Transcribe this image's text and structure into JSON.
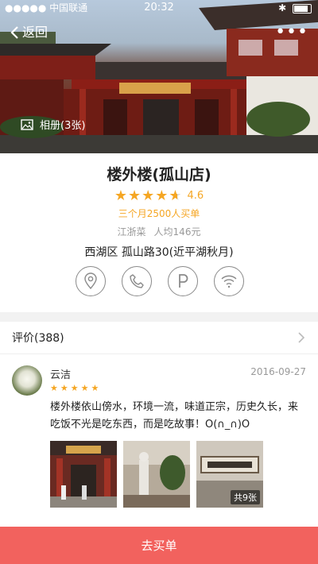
{
  "status_bar": {
    "carrier": "●●●●● 中国联通",
    "time": "20:32"
  },
  "header": {
    "back_label": "返回",
    "more_label": "•••",
    "album_label": "相册(3张)"
  },
  "shop": {
    "name": "楼外楼(孤山店)",
    "stars": "★★★★★",
    "rating": "4.6",
    "rating_fraction": 0.92,
    "sales": "三个月2500人买单",
    "cuisine": "江浙菜",
    "avg_price": "人均146元",
    "address": "西湖区 孤山路30(近平湖秋月)"
  },
  "actions": [
    {
      "icon": "location-pin-icon"
    },
    {
      "icon": "phone-icon"
    },
    {
      "icon": "parking-icon"
    },
    {
      "icon": "wifi-icon"
    }
  ],
  "reviews": {
    "title": "评价(388)",
    "items": [
      {
        "user": "云洁",
        "date": "2016-09-27",
        "stars": "★★★★★",
        "text": "楼外楼依山傍水，环境一流，味道正宗，历史久长，来吃饭不光是吃东西，而是吃故事！O(∩_∩)O",
        "photo_count_label": "共9张"
      }
    ]
  },
  "footer": {
    "buy_label": "去买单"
  },
  "colors": {
    "accent": "#f5a623",
    "buy_button": "#f2625e"
  }
}
